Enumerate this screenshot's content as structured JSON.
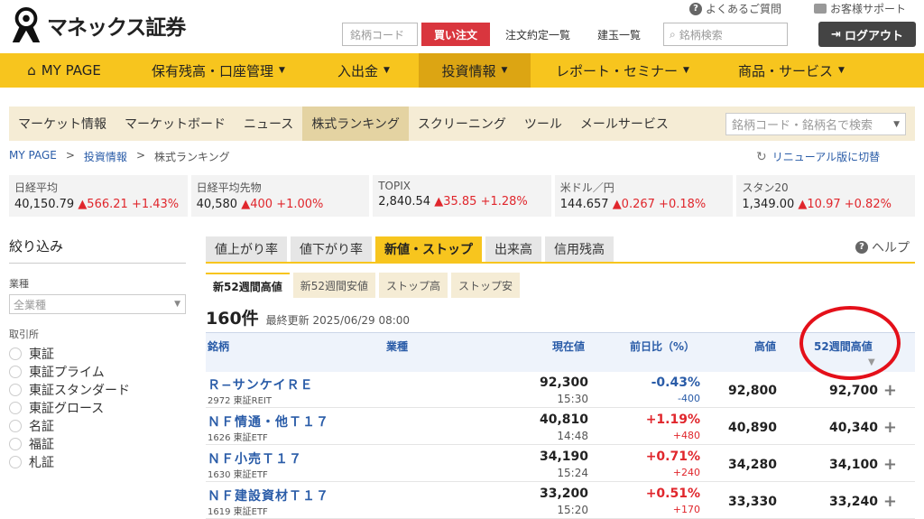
{
  "brand": {
    "name": "マネックス証券"
  },
  "top_links": {
    "faq": "よくあるご質問",
    "support": "お客様サポート"
  },
  "top_search": {
    "code_placeholder": "銘柄コード",
    "buy_label": "買い注文",
    "orders": "注文約定一覧",
    "positions": "建玉一覧",
    "stock_search_placeholder": "銘柄検索",
    "login": "ログアウト"
  },
  "nav": [
    "MY PAGE",
    "保有残高・口座管理",
    "入出金",
    "投資情報",
    "レポート・セミナー",
    "商品・サービス"
  ],
  "subnav": {
    "items": [
      "マーケット情報",
      "マーケットボード",
      "ニュース",
      "株式ランキング",
      "スクリーニング",
      "ツール",
      "メールサービス"
    ],
    "search_placeholder": "銘柄コード・銘柄名で検索"
  },
  "breadcrumb": [
    "MY PAGE",
    ">",
    "投資情報",
    ">",
    "株式ランキング"
  ],
  "renewal": "リニューアル版に切替",
  "indices": [
    {
      "name": "日経平均",
      "value": "40,150.79",
      "chg": "▲566.21",
      "pct": "+1.43%"
    },
    {
      "name": "日経平均先物",
      "value": "40,580",
      "chg": "▲400",
      "pct": "+1.00%"
    },
    {
      "name": "TOPIX",
      "value": "2,840.54",
      "chg": "▲35.85",
      "pct": "+1.28%"
    },
    {
      "name": "米ドル／円",
      "value": "144.657",
      "chg": "▲0.267",
      "pct": "+0.18%"
    },
    {
      "name": "スタン20",
      "value": "1,349.00",
      "chg": "▲10.97",
      "pct": "+0.82%"
    }
  ],
  "filter": {
    "title": "絞り込み",
    "industry_label": "業種",
    "industry_value": "全業種",
    "exchange_label": "取引所",
    "exchanges": [
      "東証",
      "東証プライム",
      "東証スタンダード",
      "東証グロース",
      "名証",
      "福証",
      "札証"
    ]
  },
  "tabs": [
    "値上がり率",
    "値下がり率",
    "新値・ストップ",
    "出来高",
    "信用残高"
  ],
  "help": "ヘルプ",
  "subtabs": [
    "新52週間高値",
    "新52週間安値",
    "ストップ高",
    "ストップ安"
  ],
  "count": {
    "value": "160件",
    "updated": "最終更新 2025/06/29 08:00"
  },
  "columns": {
    "name": "銘柄",
    "industry": "業種",
    "price": "現在値",
    "change": "前日比（%）",
    "high": "高値",
    "high52": "52週間高値"
  },
  "rows": [
    {
      "name": "Ｒ−サンケイＲＥ",
      "code": "2972 東証REIT",
      "price": "92,300",
      "time": "15:30",
      "pct": "-0.43%",
      "diff": "-400",
      "dir": "neg",
      "high": "92,800",
      "high52": "92,700"
    },
    {
      "name": "ＮＦ情通・他Ｔ１７",
      "code": "1626 東証ETF",
      "price": "40,810",
      "time": "14:48",
      "pct": "+1.19%",
      "diff": "+480",
      "dir": "pos",
      "high": "40,890",
      "high52": "40,340"
    },
    {
      "name": "ＮＦ小売Ｔ１７",
      "code": "1630 東証ETF",
      "price": "34,190",
      "time": "15:24",
      "pct": "+0.71%",
      "diff": "+240",
      "dir": "pos",
      "high": "34,280",
      "high52": "34,100"
    },
    {
      "name": "ＮＦ建設資材Ｔ１７",
      "code": "1619 東証ETF",
      "price": "33,200",
      "time": "15:20",
      "pct": "+0.51%",
      "diff": "+170",
      "dir": "pos",
      "high": "33,330",
      "high52": "33,240"
    }
  ],
  "colors": {
    "nav": "#f7c51e",
    "nav_active": "#dca513",
    "buy": "#d9363e",
    "link": "#2a5ca8",
    "up": "#e0262c",
    "annotation": "#e4101a"
  }
}
